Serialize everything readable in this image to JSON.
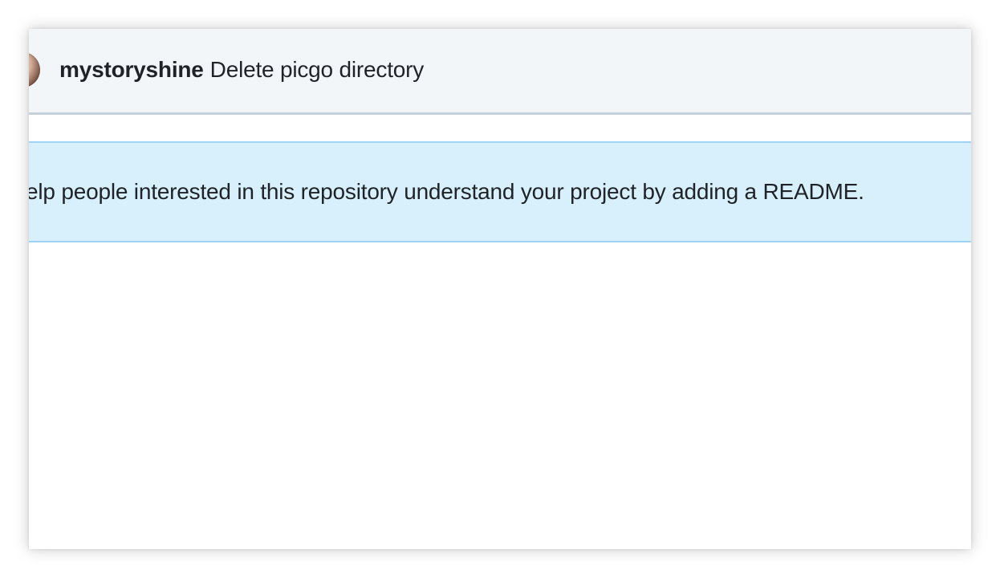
{
  "commit": {
    "author": "mystoryshine",
    "message": "Delete picgo directory"
  },
  "readme_banner": {
    "text": "elp people interested in this repository understand your project by adding a README."
  },
  "colors": {
    "commit_bar_bg": "#f3f6f9",
    "banner_bg": "#d7f0fc",
    "banner_border": "#9fd2f3",
    "text": "#1f2328"
  }
}
